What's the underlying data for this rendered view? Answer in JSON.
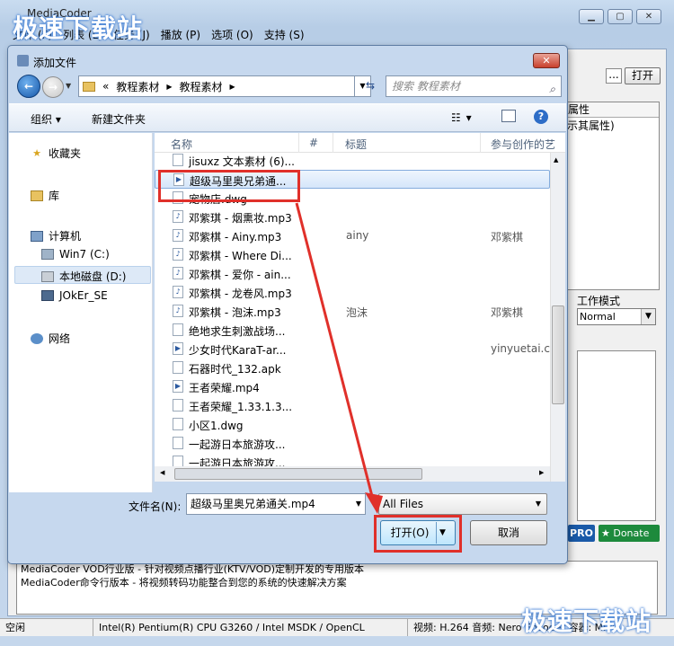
{
  "main_window": {
    "title": "MediaCoder",
    "menu": [
      "文件 (F)",
      "列表 (L)",
      "任务 (J)",
      "播放 (P)",
      "选项 (O)",
      "支持 (S)"
    ],
    "browse_button": "...",
    "open_button": "打开",
    "properties_header": "属性",
    "properties_text": "示其属性)",
    "work_mode_label": "工作模式",
    "work_mode_value": "Normal",
    "pro_badge": "PRO",
    "donate_button": "Donate",
    "info_lines": [
      "MediaCoder VOD行业版 - 针对视频点播行业(KTV/VOD)定制开发的专用版本",
      "MediaCoder命令行版本 - 将视频转码功能整合到您的系统的快速解决方案"
    ],
    "status": [
      "空闲",
      "Intel(R) Pentium(R) CPU G3260 / Intel MSDK / OpenCL",
      "视频: H.264  音频: Nero Encoder  容器: MP4"
    ]
  },
  "watermark": "极速下载站",
  "dialog": {
    "title": "添加文件",
    "close_label": "✕",
    "address": [
      "«",
      "教程素材",
      "教程素材"
    ],
    "search_placeholder": "搜索 教程素材",
    "toolbar": {
      "organize": "组织 ▾",
      "new_folder": "新建文件夹"
    },
    "nav": {
      "favorites": "收藏夹",
      "libraries": "库",
      "computer": "计算机",
      "drive_c": "Win7 (C:)",
      "drive_d": "本地磁盘 (D:)",
      "usb": "JOkEr_SE",
      "network": "网络"
    },
    "columns": {
      "name": "名称",
      "number": "#",
      "title": "标题",
      "artists": "参与创作的艺"
    },
    "files": [
      {
        "name": "jisuxz 文本素材 (6)...",
        "icon": "doc",
        "title": "",
        "artist": ""
      },
      {
        "name": "超级马里奥兄弟通...",
        "icon": "media",
        "title": "",
        "artist": ""
      },
      {
        "name": "宠物店.dwg",
        "icon": "doc",
        "title": "",
        "artist": ""
      },
      {
        "name": "邓紫琪 - 烟熏妆.mp3",
        "icon": "audio",
        "title": "",
        "artist": ""
      },
      {
        "name": "邓紫棋 - Ainy.mp3",
        "icon": "audio",
        "title": "ainy",
        "artist": "邓紫棋"
      },
      {
        "name": "邓紫棋 - Where Di...",
        "icon": "audio",
        "title": "",
        "artist": ""
      },
      {
        "name": "邓紫棋 - 爱你 - ain...",
        "icon": "audio",
        "title": "",
        "artist": ""
      },
      {
        "name": "邓紫棋 - 龙卷风.mp3",
        "icon": "audio",
        "title": "",
        "artist": ""
      },
      {
        "name": "邓紫棋 - 泡沫.mp3",
        "icon": "audio",
        "title": "泡沫",
        "artist": "邓紫棋"
      },
      {
        "name": "绝地求生刺激战场...",
        "icon": "doc",
        "title": "",
        "artist": ""
      },
      {
        "name": "少女时代KaraT-ar...",
        "icon": "media",
        "title": "",
        "artist": "yinyuetai.com"
      },
      {
        "name": "石器时代_132.apk",
        "icon": "doc",
        "title": "",
        "artist": ""
      },
      {
        "name": "王者荣耀.mp4",
        "icon": "media",
        "title": "",
        "artist": ""
      },
      {
        "name": "王者荣耀_1.33.1.3...",
        "icon": "doc",
        "title": "",
        "artist": ""
      },
      {
        "name": "小区1.dwg",
        "icon": "doc",
        "title": "",
        "artist": ""
      },
      {
        "name": "一起游日本旅游攻...",
        "icon": "doc",
        "title": "",
        "artist": ""
      },
      {
        "name": "一起游日本旅游攻...",
        "icon": "doc",
        "title": "",
        "artist": ""
      }
    ],
    "filename_label": "文件名(N):",
    "filename_value": "超级马里奥兄弟通关.mp4",
    "filter_value": "All Files",
    "open_button": "打开(O)",
    "cancel_button": "取消"
  }
}
